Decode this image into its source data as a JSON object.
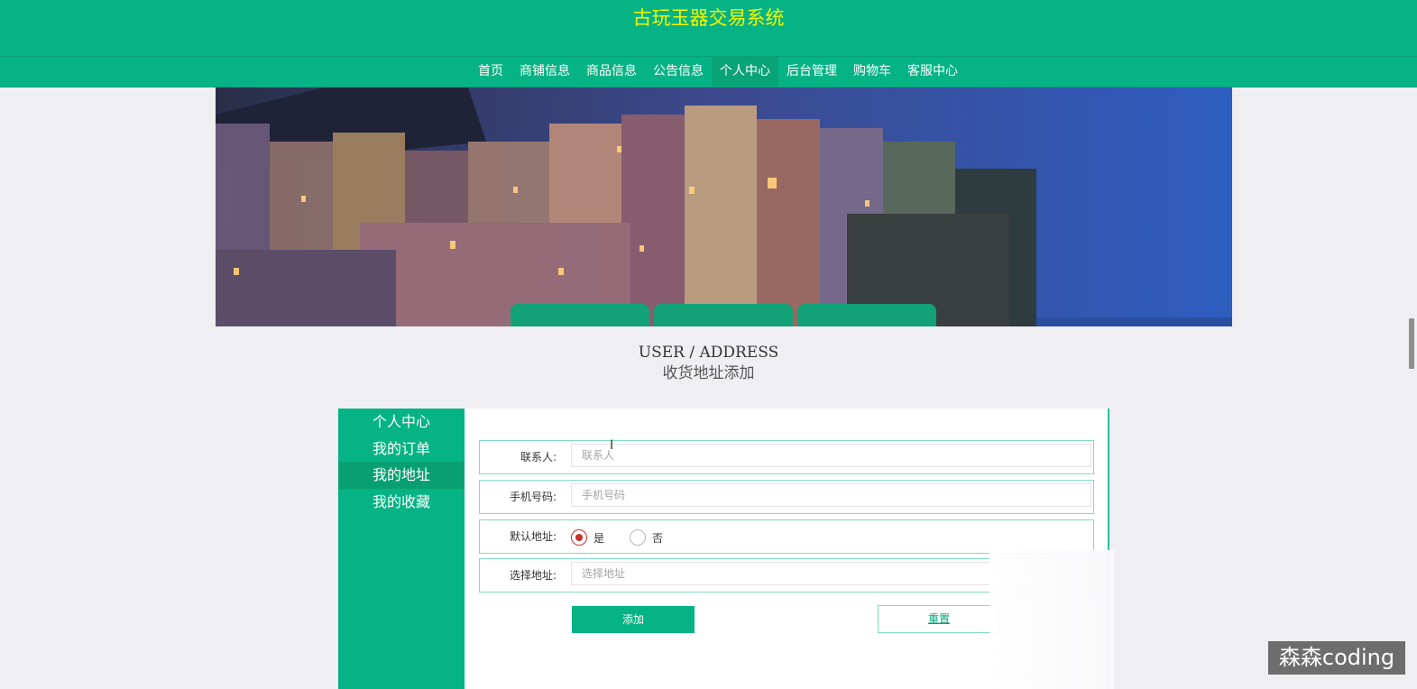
{
  "header": {
    "title": "古玩玉器交易系统"
  },
  "nav": {
    "items": [
      {
        "label": "首页"
      },
      {
        "label": "商铺信息"
      },
      {
        "label": "商品信息"
      },
      {
        "label": "公告信息"
      },
      {
        "label": "个人中心",
        "active": true
      },
      {
        "label": "后台管理"
      },
      {
        "label": "购物车"
      },
      {
        "label": "客服中心"
      }
    ]
  },
  "heading": {
    "en": "USER / ADDRESS",
    "cn": "收货地址添加"
  },
  "sidebar": {
    "items": [
      {
        "label": "个人中心"
      },
      {
        "label": "我的订单"
      },
      {
        "label": "我的地址",
        "active": true
      },
      {
        "label": "我的收藏"
      }
    ]
  },
  "form": {
    "contact": {
      "label": "联系人:",
      "placeholder": "联系人",
      "value": ""
    },
    "phone": {
      "label": "手机号码:",
      "placeholder": "手机号码",
      "value": ""
    },
    "default_address": {
      "label": "默认地址:",
      "options": [
        "是",
        "否"
      ],
      "selected": "是"
    },
    "address": {
      "label": "选择地址:",
      "placeholder": "选择地址",
      "value": ""
    },
    "add_label": "添加",
    "reset_label": "重置"
  },
  "watermark": "森森coding",
  "colors": {
    "primary": "#05b384",
    "title_yellow": "#f5f500",
    "radio_red": "#c9302c"
  }
}
